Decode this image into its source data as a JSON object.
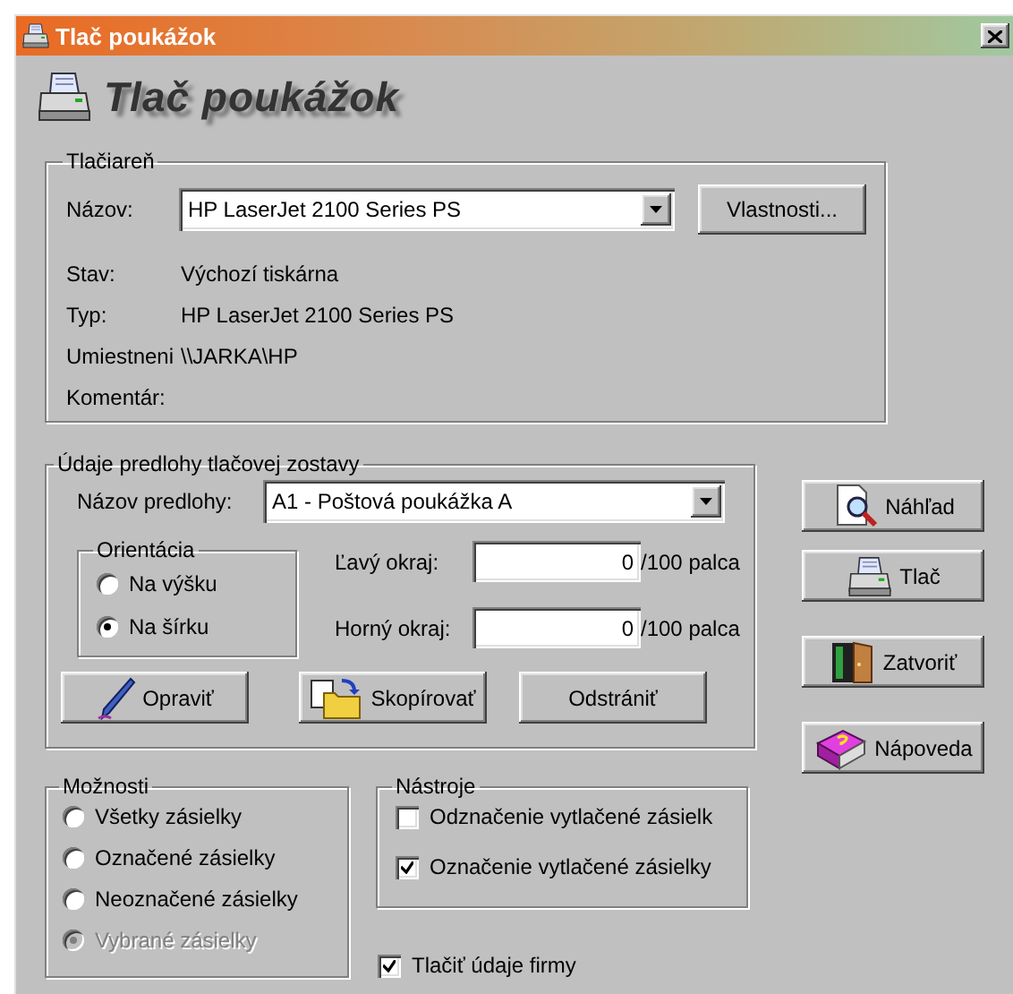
{
  "window": {
    "title": "Tlač poukážok"
  },
  "header": {
    "title": "Tlač poukážok"
  },
  "printer_group": {
    "title": "Tlačiareň",
    "name_label": "Názov:",
    "name_value": "HP LaserJet 2100 Series PS",
    "properties_button": "Vlastnosti...",
    "info": [
      {
        "label": "Stav:",
        "value": "Výchozí tiskárna"
      },
      {
        "label": "Typ:",
        "value": "HP LaserJet 2100 Series PS"
      },
      {
        "label": "Umiestneni",
        "value": "\\\\JARKA\\HP"
      },
      {
        "label": "Komentár:"
      }
    ]
  },
  "template_group": {
    "title": "Údaje predlohy tlačovej zostavy",
    "template_label": "Názov predlohy:",
    "template_value": "A1 - Poštová poukážka A",
    "orientation": {
      "title": "Orientácia",
      "options": [
        {
          "label": "Na výšku",
          "selected": false
        },
        {
          "label": "Na šírku",
          "selected": true
        }
      ]
    },
    "margins": [
      {
        "label": "Ľavý okraj:",
        "value": "0",
        "unit": "/100 palca"
      },
      {
        "label": "Horný okraj:",
        "value": "0",
        "unit": "/100 palca"
      }
    ],
    "buttons": [
      {
        "label": "Opraviť",
        "kind": "pen"
      },
      {
        "label": "Skopírovať",
        "kind": "folder"
      },
      {
        "label": "Odstrániť",
        "kind": "plain"
      }
    ]
  },
  "side_buttons": [
    {
      "label": "Náhľad",
      "kind": "preview"
    },
    {
      "label": "Tlač",
      "kind": "print"
    },
    {
      "label": "Zatvoriť",
      "kind": "door"
    },
    {
      "label": "Nápoveda",
      "kind": "book"
    }
  ],
  "options_group": {
    "title": "Možnosti",
    "options": [
      {
        "label": "Všetky zásielky",
        "selected": false,
        "disabled": false
      },
      {
        "label": "Označené zásielky",
        "selected": false,
        "disabled": false
      },
      {
        "label": "Neoznačené zásielky",
        "selected": false,
        "disabled": false
      },
      {
        "label": "Vybrané zásielky",
        "selected": true,
        "disabled": true
      }
    ]
  },
  "tools_group": {
    "title": "Nástroje",
    "items": [
      {
        "label": "Odznačenie vytlačené zásielk",
        "checked": false
      },
      {
        "label": "Označenie vytlačené zásielky",
        "checked": true
      }
    ]
  },
  "print_company": {
    "label": "Tlačiť údaje firmy",
    "checked": true
  }
}
